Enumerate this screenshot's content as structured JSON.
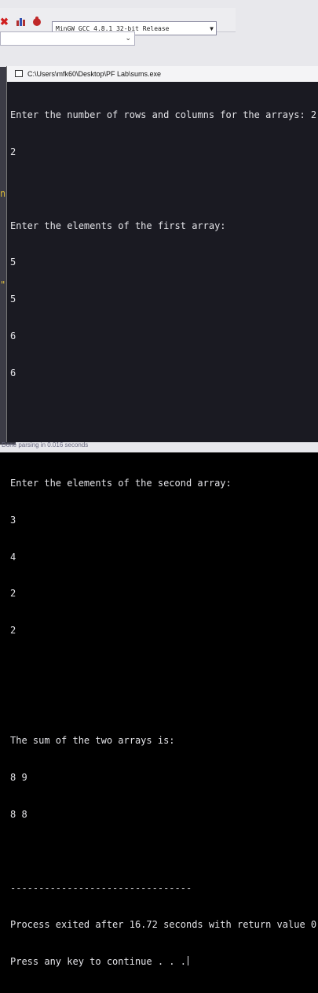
{
  "ide": {
    "compiler_select": "MinGW GCC 4.8.1 32-bit Release",
    "status": "Done parsing in 0.016 seconds",
    "left_glyphs": [
      "nd",
      "\""
    ]
  },
  "console": {
    "title": "C:\\Users\\mfk60\\Desktop\\PF Lab\\sums.exe",
    "lines": [
      "Enter the number of rows and columns for the arrays: 2",
      "2",
      "",
      "Enter the elements of the first array:",
      "5",
      "5",
      "6",
      "6",
      "",
      "",
      "Enter the elements of the second array:",
      "3",
      "4",
      "2",
      "2",
      "",
      "",
      "The sum of the two arrays is:",
      "8 9",
      "8 8",
      "",
      "--------------------------------",
      "Process exited after 16.72 seconds with return value 0",
      "Press any key to continue . . ."
    ]
  },
  "icons": [
    "close-icon",
    "chart-icon",
    "debug-icon"
  ],
  "colors": {
    "console_bg": "#1a1a22",
    "console_text": "#e4e4e8",
    "ide_bg": "#e8e8ec"
  }
}
